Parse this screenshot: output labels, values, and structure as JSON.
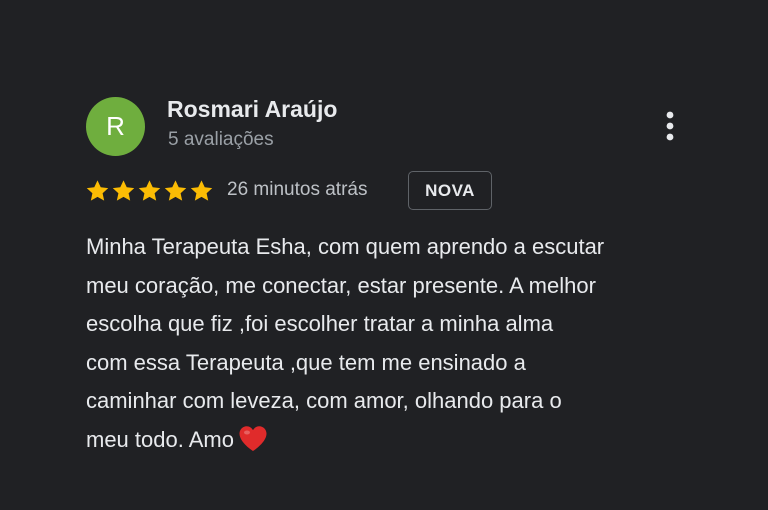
{
  "review": {
    "author": {
      "initial": "R",
      "name": "Rosmari Araújo",
      "review_count": "5 avaliações",
      "avatar_color": "#6fae3e"
    },
    "rating": 5,
    "rating_max": 5,
    "star_color": "#fbbc04",
    "time": "26 minutos atrás",
    "badge": "NOVA",
    "text_lines": [
      "Minha Terapeuta Esha, com quem aprendo a escutar",
      "meu coração, me conectar, estar presente. A melhor",
      "escolha que fiz ,foi escolher tratar a minha alma",
      "com essa Terapeuta ,que tem me ensinado a",
      "caminhar com leveza, com amor, olhando para o",
      "meu todo. Amo"
    ],
    "trailing_emoji": "heart-icon",
    "heart_color": "#e02b2b",
    "more_options_icon": "more-vert-icon"
  }
}
